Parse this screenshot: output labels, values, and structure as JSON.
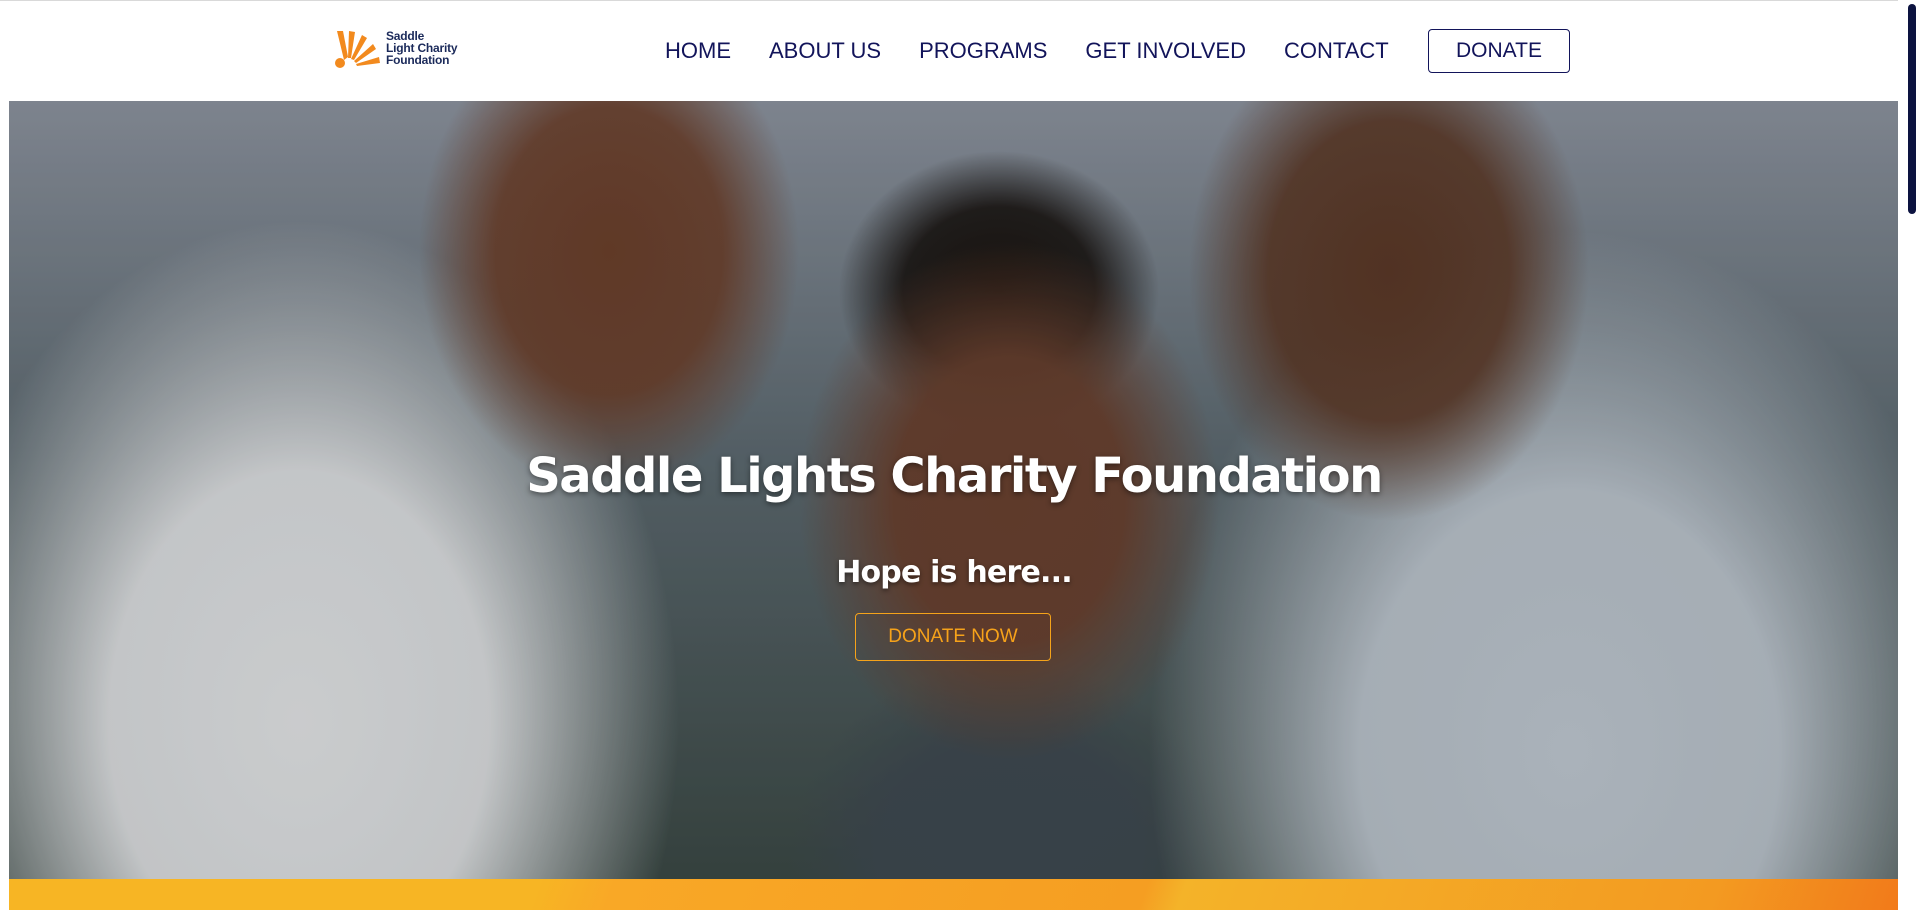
{
  "header": {
    "logo": {
      "lines": [
        "Saddle",
        "Light Charity",
        "Foundation"
      ],
      "accent": "#F28A1E",
      "text_color": "#1B2A5A"
    },
    "nav": {
      "items": [
        {
          "label": "HOME"
        },
        {
          "label": "ABOUT US"
        },
        {
          "label": "PROGRAMS"
        },
        {
          "label": "GET INVOLVED"
        },
        {
          "label": "CONTACT"
        }
      ],
      "donate_label": "DONATE",
      "color": "#12145A"
    }
  },
  "hero": {
    "title": "Saddle Lights Charity Foundation",
    "subtitle": "Hope is here...",
    "cta_label": "DONATE NOW",
    "cta_color": "#F6A21A"
  },
  "bottom_band": {
    "colors": [
      "#F7B524",
      "#F59E22",
      "#F27A1A"
    ]
  }
}
